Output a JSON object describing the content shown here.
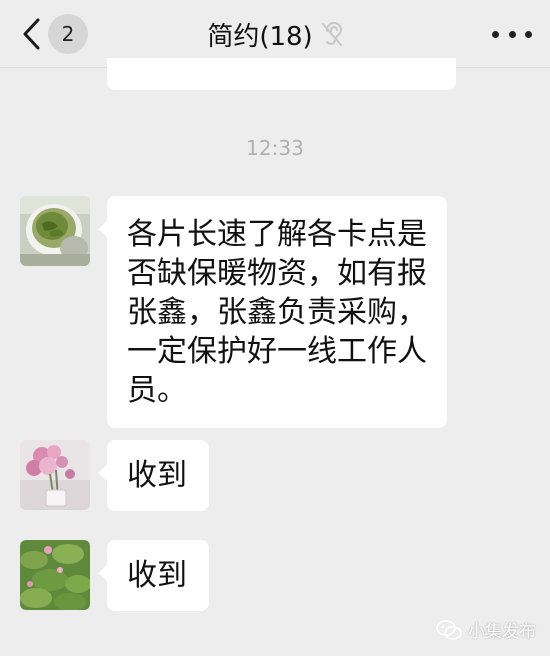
{
  "header": {
    "back_icon": "chevron-left-icon",
    "unread_count": "2",
    "title": "简约(18)",
    "mute_icon": "ear-off-icon",
    "more_icon": "more-dots-icon"
  },
  "timestamp": "12:33",
  "messages": [
    {
      "avatar": "green-tea-cup-avatar",
      "text": "各片长速了解各卡点是否缺保暖物资，如有报张鑫，张鑫负责采购，一定保护好一线工作人员。"
    },
    {
      "avatar": "pink-flowers-avatar",
      "text": "收到"
    },
    {
      "avatar": "lotus-pond-avatar",
      "text": "收到"
    }
  ],
  "watermark": {
    "icon": "wechat-icon",
    "text": "小集发布"
  },
  "colors": {
    "background": "#ededed",
    "bubble": "#ffffff",
    "timestamp": "#b0b0b0"
  }
}
